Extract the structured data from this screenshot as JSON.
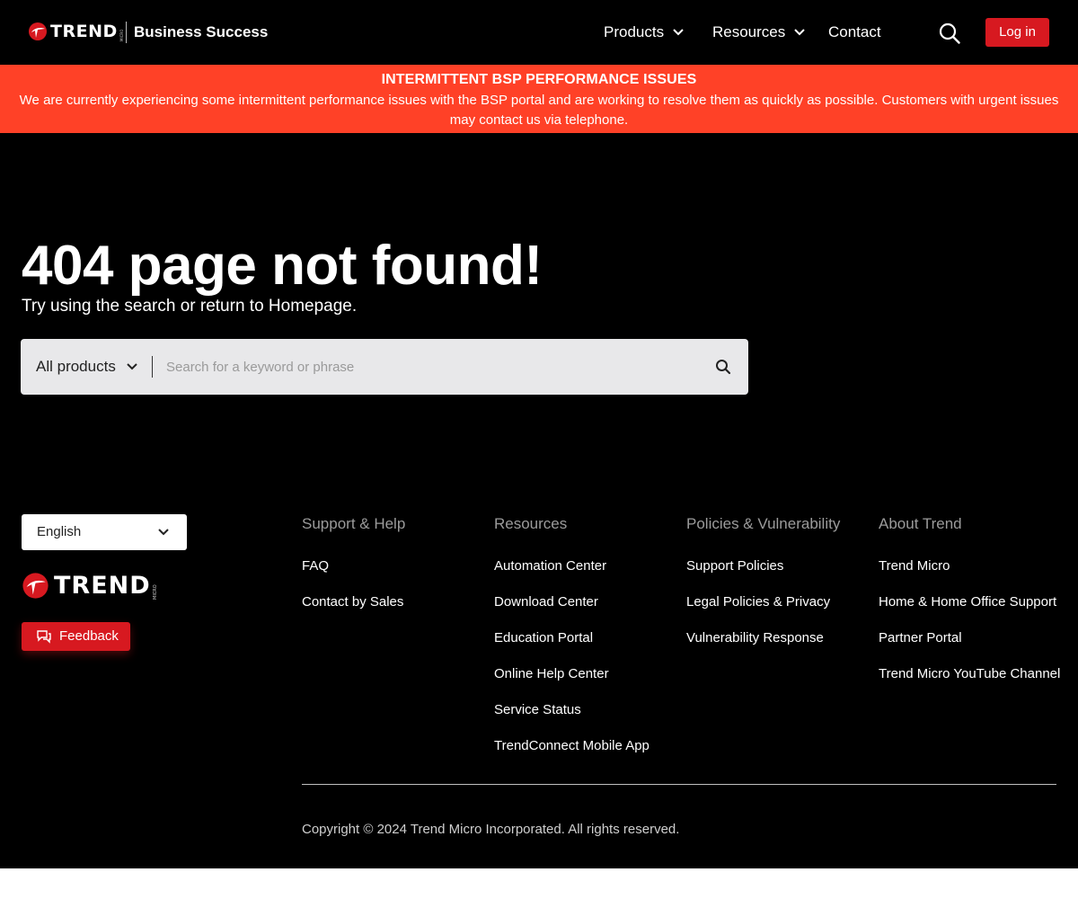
{
  "header": {
    "logo_text": "TREND",
    "logo_micro": "MICRO",
    "brand_name": "Business Success",
    "nav": [
      {
        "label": "Products",
        "icon": "chevron-down-icon"
      },
      {
        "label": "Resources",
        "icon": "chevron-down-icon"
      },
      {
        "label": "Contact"
      }
    ],
    "search_icon": "search-icon",
    "login_label": "Log in"
  },
  "alert": {
    "title": "INTERMITTENT BSP PERFORMANCE ISSUES",
    "message": "We are currently experiencing some intermittent performance issues with the BSP portal and are working to resolve them as quickly as possible.  Customers with urgent issues may contact us via telephone."
  },
  "hero": {
    "title": "404 page not found!",
    "subtitle": "Try using the search or return to Homepage."
  },
  "search": {
    "product_selected": "All products",
    "placeholder": "Search for a keyword or phrase",
    "value": ""
  },
  "footer": {
    "language": "English",
    "feedback_label": "Feedback",
    "columns": [
      {
        "heading": "Support & Help",
        "links": [
          "FAQ",
          "Contact by Sales"
        ]
      },
      {
        "heading": "Resources",
        "links": [
          "Automation Center",
          "Download Center",
          "Education Portal",
          "Online Help Center",
          "Service Status",
          "TrendConnect Mobile App"
        ]
      },
      {
        "heading": "Policies & Vulnerability",
        "links": [
          "Support Policies",
          "Legal Policies & Privacy",
          "Vulnerability Response"
        ]
      },
      {
        "heading": "About Trend",
        "links": [
          "Trend Micro",
          "Home & Home Office Support",
          "Partner Portal",
          "Trend Micro YouTube Channel"
        ]
      }
    ],
    "copyright": "Copyright © 2024 Trend Micro Incorporated. All rights reserved."
  },
  "colors": {
    "brand_red": "#d71920",
    "alert_orange": "#ff4127",
    "background": "#000000",
    "search_bg": "#e8e8ea"
  }
}
